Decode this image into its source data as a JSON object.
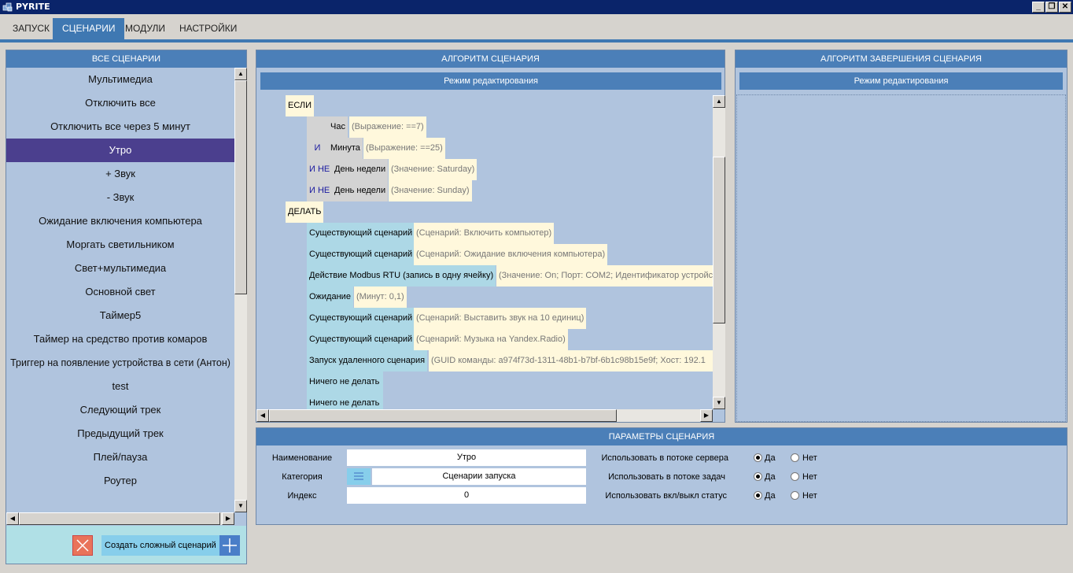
{
  "window": {
    "title": "PYRITE",
    "min_glyph": "_",
    "max_glyph": "❐",
    "close_glyph": "✕",
    "icon": "pyrite-icon"
  },
  "tabs": [
    {
      "label": "ЗАПУСК"
    },
    {
      "label": "СЦЕНАРИИ"
    },
    {
      "label": "МОДУЛИ"
    },
    {
      "label": "НАСТРОЙКИ"
    }
  ],
  "active_tab": "СЦЕНАРИИ",
  "scenarios": {
    "header": "ВСЕ СЦЕНАРИИ",
    "selected": "Утро",
    "items": [
      "Мультимедиа",
      "Отключить все",
      "Отключить все через 5 минут",
      "Утро",
      "+ Звук",
      "- Звук",
      "Ожидание включения компьютера",
      "Моргать светильником",
      "Свет+мультимедиа",
      "Основной свет",
      "Таймер5",
      "Таймер на средство против комаров",
      "Триггер на появление устройства в сети (Антон)",
      "test",
      "Следующий трек",
      "Предыдущий трек",
      "Плей/пауза",
      "Роутер"
    ],
    "create_label": "Создать сложный сценарий",
    "delete_icon": "close-icon",
    "add_icon": "plus-icon"
  },
  "algorithm": {
    "header": "АЛГОРИТМ СЦЕНАРИЯ",
    "mode": "Режим редактирования",
    "if_label": "ЕСЛИ",
    "do_label": "ДЕЛАТЬ",
    "conditions": [
      {
        "op": "",
        "name": "Час",
        "param": "(Выражение: ==7)"
      },
      {
        "op": "И",
        "name": "Минута",
        "param": "(Выражение: ==25)"
      },
      {
        "op": "И НЕ",
        "name": "День недели",
        "param": "(Значение: Saturday)"
      },
      {
        "op": "И НЕ",
        "name": "День недели",
        "param": "(Значение: Sunday)"
      }
    ],
    "actions": [
      {
        "name": "Существующий сценарий",
        "param": "(Сценарий: Включить компьютер)"
      },
      {
        "name": "Существующий сценарий",
        "param": "(Сценарий: Ожидание включения компьютера)"
      },
      {
        "name": "Действие Modbus RTU (запись в одну ячейку)",
        "param": "(Значение: On; Порт: COM2; Идентификатор устройс"
      },
      {
        "name": "Ожидание",
        "param": "(Минут: 0,1)"
      },
      {
        "name": "Существующий сценарий",
        "param": "(Сценарий: Выставить звук на 10 единиц)"
      },
      {
        "name": "Существующий сценарий",
        "param": "(Сценарий: Музыка на Yandex.Radio)"
      },
      {
        "name": "Запуск удаленного сценария",
        "param": "(GUID команды: a974f73d-1311-48b1-b7bf-6b1c98b15e9f; Хост: 192.1"
      },
      {
        "name": "Ничего не делать",
        "param": ""
      },
      {
        "name": "Ничего не делать",
        "param": ""
      }
    ]
  },
  "finish_algorithm": {
    "header": "АЛГОРИТМ ЗАВЕРШЕНИЯ СЦЕНАРИЯ",
    "mode": "Режим редактирования"
  },
  "params": {
    "header": "ПАРАМЕТРЫ СЦЕНАРИЯ",
    "name_label": "Наименование",
    "name_value": "Утро",
    "category_label": "Категория",
    "category_value": "Сценарии запуска",
    "category_icon": "list-icon",
    "index_label": "Индекс",
    "index_value": "0",
    "options": [
      {
        "label": "Использовать в потоке сервера",
        "yes": "Да",
        "no": "Нет",
        "selected": "Да"
      },
      {
        "label": "Использовать в потоке задач",
        "yes": "Да",
        "no": "Нет",
        "selected": "Да"
      },
      {
        "label": "Использовать вкл/выкл статус",
        "yes": "Да",
        "no": "Нет",
        "selected": "Да"
      }
    ]
  }
}
